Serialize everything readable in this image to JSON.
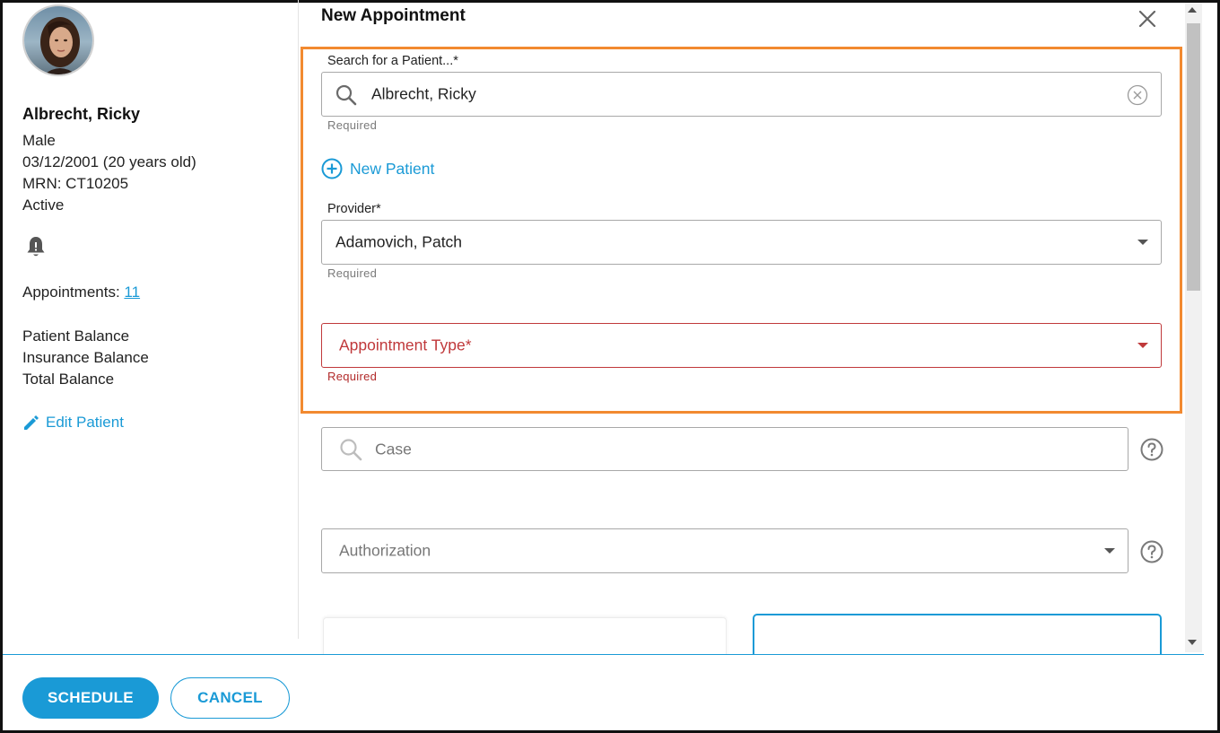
{
  "patient": {
    "name": "Albrecht, Ricky",
    "gender": "Male",
    "dob": "03/12/2001 (20 years old)",
    "mrn": "MRN: CT10205",
    "status": "Active",
    "appointments_label": "Appointments: ",
    "appointments_count": "11",
    "patient_balance_label": "Patient Balance",
    "insurance_balance_label": "Insurance Balance",
    "total_balance_label": "Total Balance",
    "edit_label": "Edit Patient"
  },
  "form": {
    "title": "New Appointment",
    "patient_search": {
      "label": "Search for a Patient...*",
      "value": "Albrecht, Ricky",
      "helper": "Required"
    },
    "new_patient_label": "New Patient",
    "provider": {
      "label": "Provider*",
      "value": "Adamovich, Patch",
      "helper": "Required"
    },
    "appointment_type": {
      "placeholder": "Appointment Type*",
      "helper": "Required"
    },
    "case": {
      "placeholder": "Case"
    },
    "authorization": {
      "placeholder": "Authorization"
    }
  },
  "footer": {
    "schedule_label": "SCHEDULE",
    "cancel_label": "CANCEL"
  },
  "icons": {
    "close": "close-icon",
    "search": "search-icon",
    "clear": "clear-icon",
    "add": "add-circle-icon",
    "bell": "bell-icon",
    "edit": "pencil-icon",
    "help": "help-icon",
    "dropdown": "chevron-down-icon"
  },
  "colors": {
    "accent": "#1a9ad6",
    "error": "#c0393b",
    "highlight": "#f28a30"
  }
}
